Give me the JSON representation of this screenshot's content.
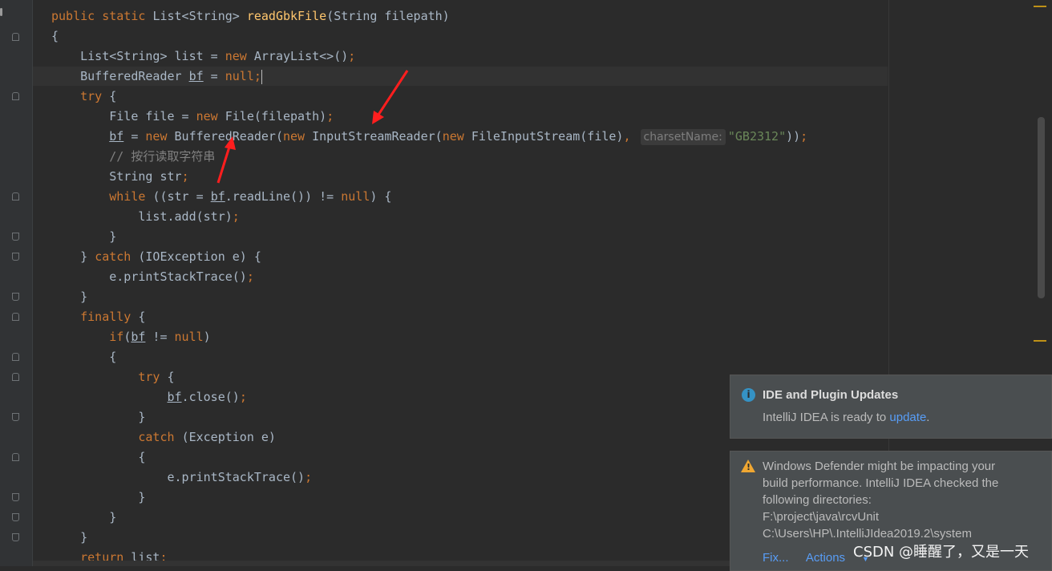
{
  "code": {
    "lines": [
      {
        "t": "public static List<String> readGbkFile(String filepath)"
      },
      {
        "t": "{"
      },
      {
        "t": "    List<String> list = new ArrayList<>();"
      },
      {
        "t": "    BufferedReader bf = null;"
      },
      {
        "t": "    try {"
      },
      {
        "t": "        File file = new File(filepath);"
      },
      {
        "t": "        bf = new BufferedReader(new InputStreamReader(new FileInputStream(file), charsetName: \"GB2312\"));"
      },
      {
        "t": "        // 按行读取字符串"
      },
      {
        "t": "        String str;"
      },
      {
        "t": "        while ((str = bf.readLine()) != null) {"
      },
      {
        "t": "            list.add(str);"
      },
      {
        "t": "        }"
      },
      {
        "t": "    } catch (IOException e) {"
      },
      {
        "t": "        e.printStackTrace();"
      },
      {
        "t": "    }"
      },
      {
        "t": "    finally {"
      },
      {
        "t": "        if(bf != null)"
      },
      {
        "t": "        {"
      },
      {
        "t": "            try {"
      },
      {
        "t": "                bf.close();"
      },
      {
        "t": "            }"
      },
      {
        "t": "            catch (Exception e)"
      },
      {
        "t": "            {"
      },
      {
        "t": "                e.printStackTrace();"
      },
      {
        "t": "            }"
      },
      {
        "t": "        }"
      },
      {
        "t": "    }"
      },
      {
        "t": "    return list;"
      }
    ],
    "param_hint": "charsetName:",
    "charset": "\"GB2312\"",
    "comment": "// 按行读取字符串"
  },
  "notifications": {
    "updates": {
      "title": "IDE and Plugin Updates",
      "body_prefix": "IntelliJ IDEA is ready to ",
      "link": "update",
      "body_suffix": "."
    },
    "defender": {
      "body_1": "Windows Defender might be impacting your",
      "body_2": "build performance. IntelliJ IDEA checked the",
      "body_3": "following directories:",
      "dir_1": "F:\\project\\java\\rcvUnit",
      "dir_2": "C:\\Users\\HP\\.IntelliJIdea2019.2\\system",
      "fix": "Fix...",
      "actions": "Actions"
    }
  },
  "watermark": "CSDN @睡醒了，又是一天",
  "colors": {
    "keyword": "#cc7832",
    "method": "#ffc66d",
    "string": "#6a8759",
    "comment": "#808080",
    "text": "#a9b7c6",
    "link": "#589df6",
    "arrow": "#ff1e1e"
  }
}
